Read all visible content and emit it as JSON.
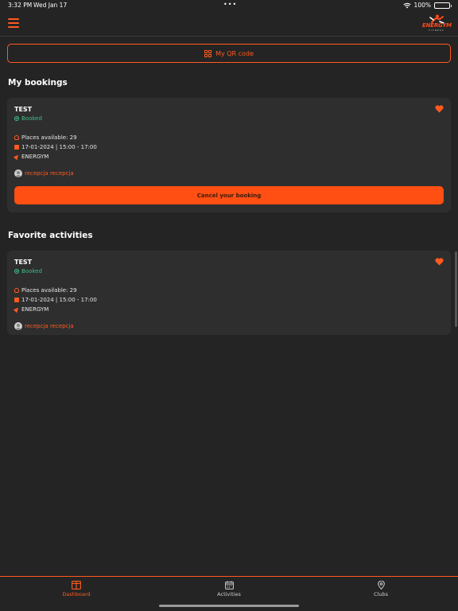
{
  "status_bar": {
    "time": "3:32 PM",
    "date": "Wed Jan 17",
    "battery": "100%",
    "battery_level": 1.0
  },
  "header": {
    "logo_text": "ENERGYM",
    "logo_subtext": "FITNESS"
  },
  "qr_button": {
    "label": "My QR code",
    "icon": "qr-code-icon"
  },
  "my_bookings": {
    "title": "My bookings",
    "cards": [
      {
        "name": "TEST",
        "status": "Booked",
        "places": "Places available: 29",
        "datetime": "17-01-2024 | 15:00 - 17:00",
        "club": "ENERGYM",
        "trainer": "recepcja recepcja",
        "cancel_label": "Cancel your booking",
        "favorite": true
      }
    ]
  },
  "favorite_activities": {
    "title": "Favorite activities",
    "cards": [
      {
        "name": "TEST",
        "status": "Booked",
        "places": "Places available: 29",
        "datetime": "17-01-2024 | 15:00 - 17:00",
        "club": "ENERGYM",
        "trainer": "recepcja recepcja",
        "favorite": true
      }
    ]
  },
  "tabs": [
    {
      "label": "Dashboard",
      "icon": "dashboard-icon",
      "active": true
    },
    {
      "label": "Activities",
      "icon": "calendar-icon",
      "active": false
    },
    {
      "label": "Clubs",
      "icon": "map-pin-icon",
      "active": false
    }
  ],
  "colors": {
    "background": "#242424",
    "card": "#2e2e2e",
    "accent": "#ff5a1f",
    "status_green": "#3dbf88"
  }
}
